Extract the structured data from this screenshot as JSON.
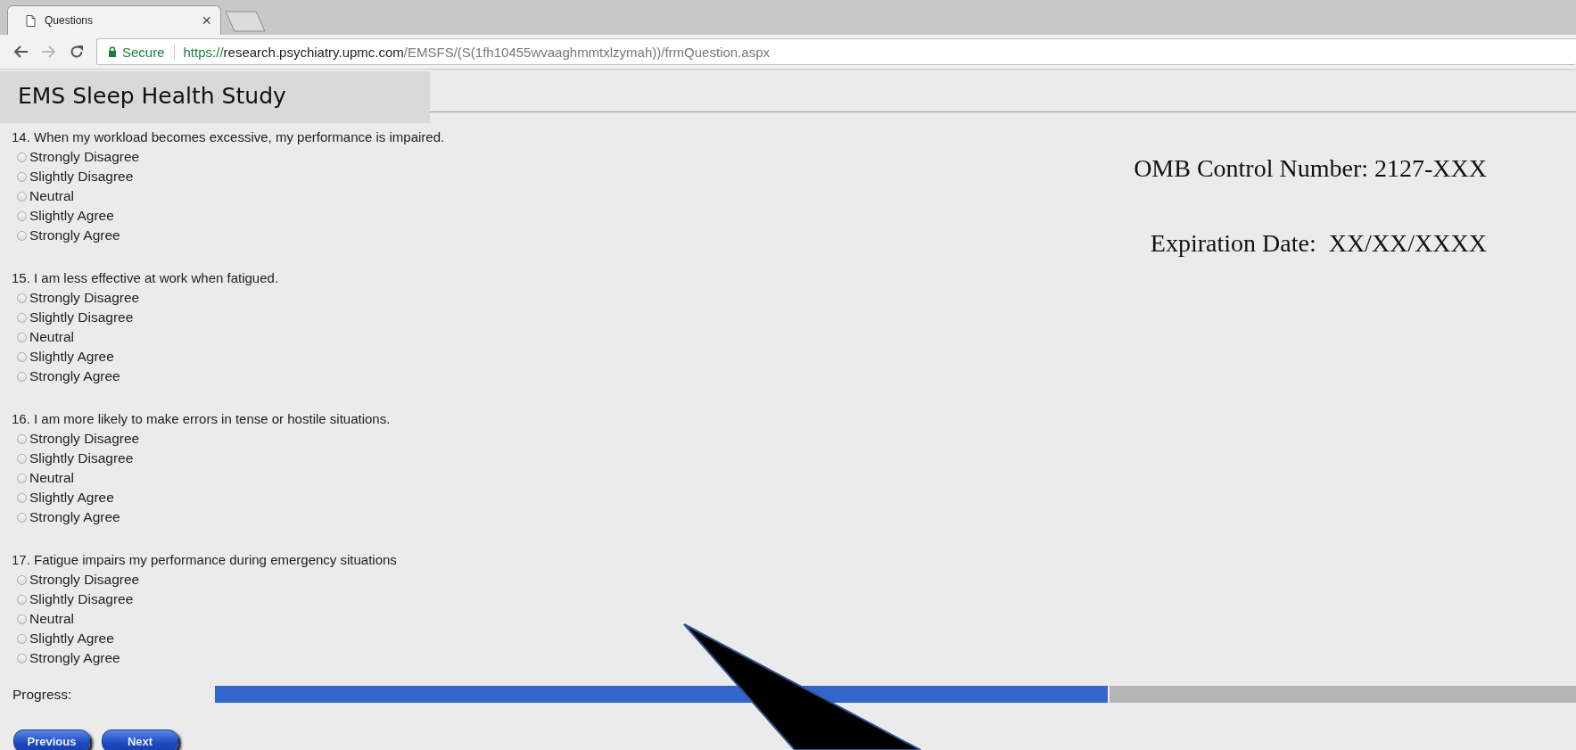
{
  "browser": {
    "tab": {
      "title": "Questions",
      "close": "×"
    },
    "secure_label": "Secure",
    "url": {
      "scheme": "https://",
      "host": "research.psychiatry.upmc.com",
      "path": "/EMSFS/(S(1fh10455wvaaghmmtxlzymah))/frmQuestion.aspx"
    }
  },
  "header": {
    "title": "EMS Sleep Health Study"
  },
  "omb": {
    "control_number": "OMB Control Number: 2127-XXX",
    "expiration": "Expiration Date:  XX/XX/XXXX"
  },
  "questions": [
    {
      "text": "14. When my workload becomes excessive, my performance is impaired.",
      "options": [
        {
          "label": "Strongly Disagree",
          "selected": false
        },
        {
          "label": "Slightly Disagree",
          "selected": false
        },
        {
          "label": "Neutral",
          "selected": false
        },
        {
          "label": "Slightly Agree",
          "selected": false
        },
        {
          "label": "Strongly Agree",
          "selected": false
        }
      ]
    },
    {
      "text": "15. I am less effective at work when fatigued.",
      "options": [
        {
          "label": "Strongly Disagree",
          "selected": false
        },
        {
          "label": "Slightly Disagree",
          "selected": false
        },
        {
          "label": "Neutral",
          "selected": false
        },
        {
          "label": "Slightly Agree",
          "selected": false
        },
        {
          "label": "Strongly Agree",
          "selected": false
        }
      ]
    },
    {
      "text": "16. I am more likely to make errors in tense or hostile situations.",
      "options": [
        {
          "label": "Strongly Disagree",
          "selected": false
        },
        {
          "label": "Slightly Disagree",
          "selected": false
        },
        {
          "label": "Neutral",
          "selected": false
        },
        {
          "label": "Slightly Agree",
          "selected": false
        },
        {
          "label": "Strongly Agree",
          "selected": false
        }
      ]
    },
    {
      "text": "17. Fatigue impairs my performance during emergency situations",
      "options": [
        {
          "label": "Strongly Disagree",
          "selected": false
        },
        {
          "label": "Slightly Disagree",
          "selected": false
        },
        {
          "label": "Neutral",
          "selected": false
        },
        {
          "label": "Slightly Agree",
          "selected": false
        },
        {
          "label": "Strongly Agree",
          "selected": false
        }
      ]
    }
  ],
  "progress": {
    "label": "Progress:",
    "level": 0.657
  },
  "buttons": [
    {
      "label": "Previous"
    },
    {
      "label": "Next"
    }
  ]
}
